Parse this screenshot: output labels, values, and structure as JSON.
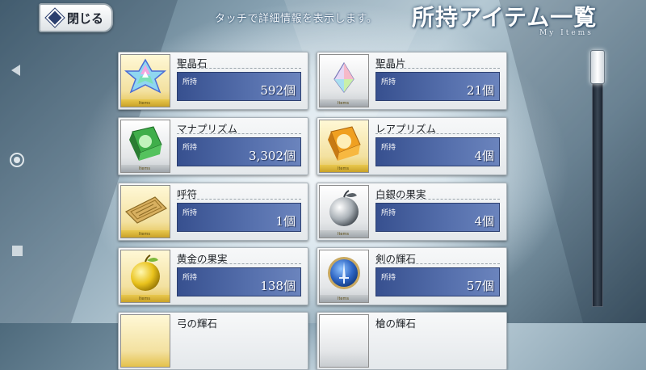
{
  "header": {
    "close_label": "閉じる",
    "hint": "タッチで詳細情報を表示します。",
    "title": "所持アイテム一覧",
    "subtitle": "My Items"
  },
  "count_label": "所持",
  "thumb_tag": "Items",
  "items": [
    {
      "name": "聖晶石",
      "count": "592個",
      "icon": "saint-quartz-icon"
    },
    {
      "name": "聖晶片",
      "count": "21個",
      "icon": "quartz-fragment-icon"
    },
    {
      "name": "マナプリズム",
      "count": "3,302個",
      "icon": "mana-prism-icon"
    },
    {
      "name": "レアプリズム",
      "count": "4個",
      "icon": "rare-prism-icon"
    },
    {
      "name": "呼符",
      "count": "1個",
      "icon": "summon-ticket-icon"
    },
    {
      "name": "白銀の果実",
      "count": "4個",
      "icon": "silver-apple-icon"
    },
    {
      "name": "黄金の果実",
      "count": "138個",
      "icon": "golden-apple-icon"
    },
    {
      "name": "剣の輝石",
      "count": "57個",
      "icon": "saber-gem-icon"
    },
    {
      "name": "弓の輝石",
      "count": "",
      "icon": "archer-gem-icon"
    },
    {
      "name": "槍の輝石",
      "count": "",
      "icon": "lancer-gem-icon"
    }
  ],
  "colors": {
    "count_box": "#4a64a3",
    "gold_frame": "#e4c14c",
    "silver_frame": "#c8ccd0"
  }
}
